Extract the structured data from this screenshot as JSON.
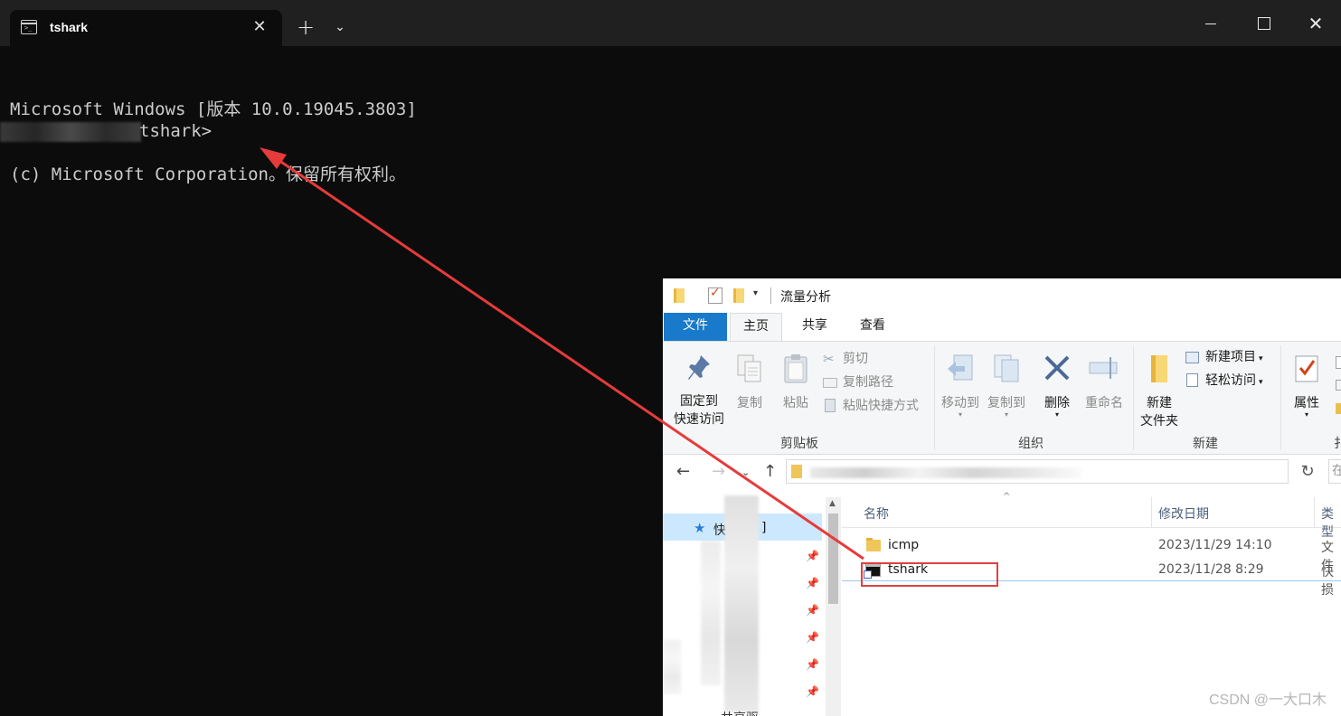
{
  "terminal": {
    "tab_title": "tshark",
    "line1": "Microsoft Windows [版本 10.0.19045.3803]",
    "line2": "(c) Microsoft Corporation。保留所有权利。",
    "prompt_visible": "tshark>"
  },
  "explorer": {
    "window_title": "流量分析",
    "tabs": {
      "file": "文件",
      "home": "主页",
      "share": "共享",
      "view": "查看"
    },
    "ribbon": {
      "pin_quick_access_l1": "固定到",
      "pin_quick_access_l2": "快速访问",
      "copy": "复制",
      "paste": "粘贴",
      "cut": "剪切",
      "copy_path": "复制路径",
      "paste_shortcut": "粘贴快捷方式",
      "clipboard_group": "剪贴板",
      "move_to": "移动到",
      "copy_to": "复制到",
      "delete": "删除",
      "rename": "重命名",
      "organize_group": "组织",
      "new_folder_l1": "新建",
      "new_folder_l2": "文件夹",
      "new_item": "新建项目",
      "easy_access": "轻松访问",
      "new_group": "新建",
      "properties": "属性",
      "open_group_partial": "扌"
    },
    "search_stub": "在",
    "nav": {
      "quick_access": "快",
      "quick_access_tail": "]",
      "partial_item": "共享驱"
    },
    "columns": {
      "name": "名称",
      "date": "修改日期",
      "type": "类型"
    },
    "files": [
      {
        "name": "icmp",
        "date": "2023/11/29 14:10",
        "type": "文件"
      },
      {
        "name": "tshark",
        "date": "2023/11/28 8:29",
        "type": "快损"
      }
    ]
  },
  "watermark": "CSDN @一大口木",
  "colors": {
    "terminal_bg": "#0c0c0c",
    "arrow": "#e63b3b",
    "ribbon_blue": "#1979ca"
  }
}
